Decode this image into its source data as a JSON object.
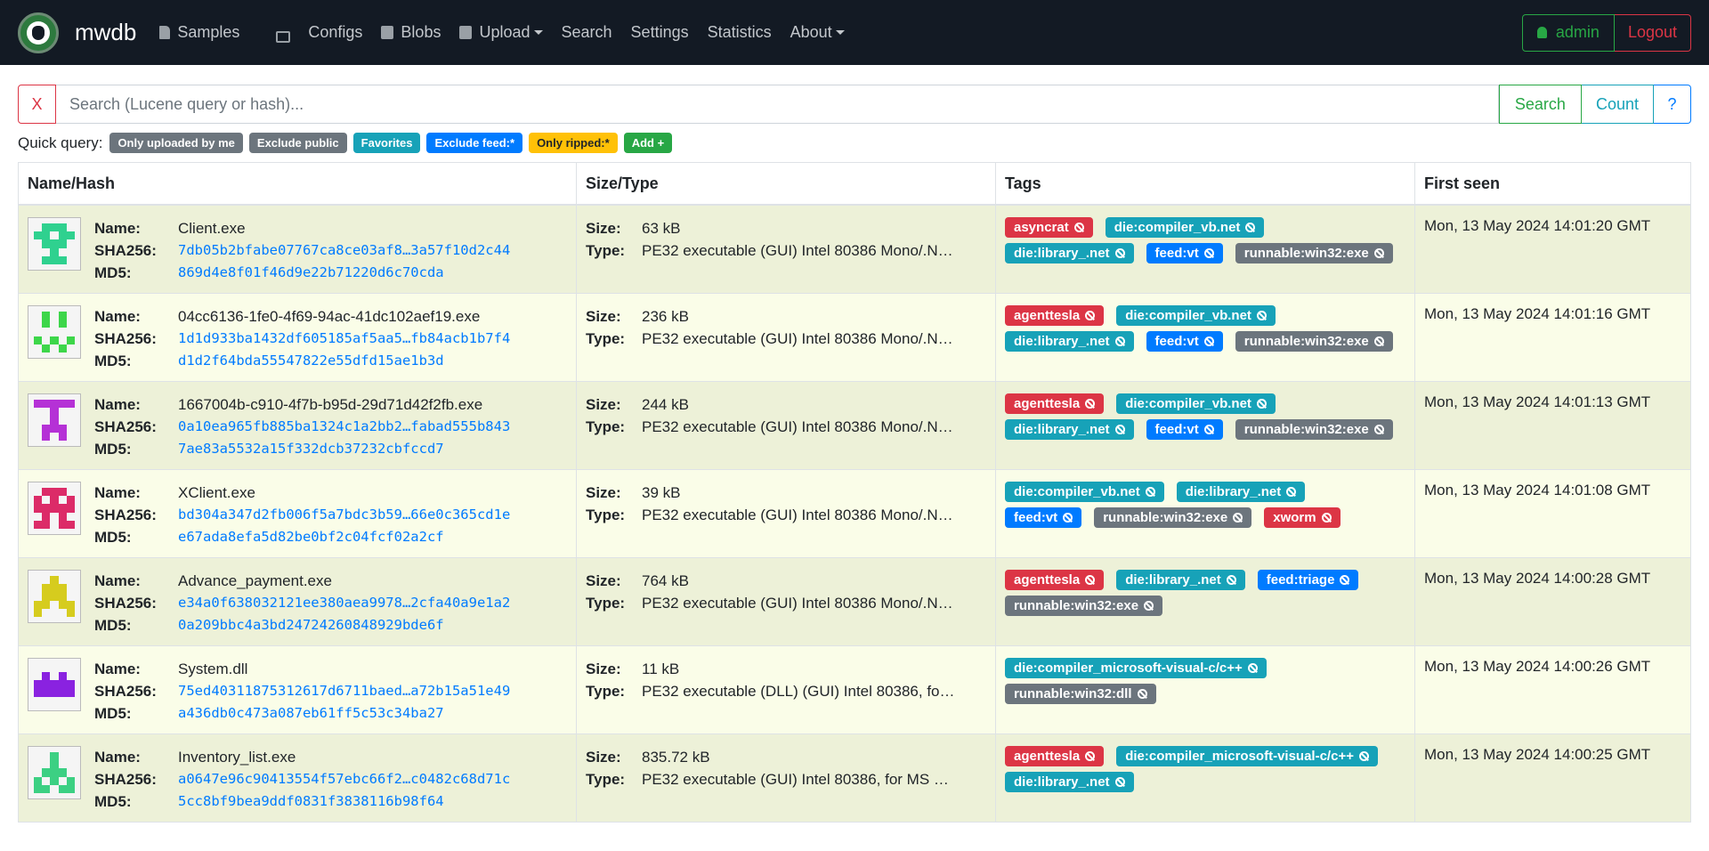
{
  "nav": {
    "brand": "mwdb",
    "items": [
      {
        "label": "Samples",
        "icon": "file-icon"
      },
      {
        "label": "Configs",
        "icon": "table-icon"
      },
      {
        "label": "Blobs",
        "icon": "blobs-icon"
      },
      {
        "label": "Upload",
        "icon": "upload-icon"
      },
      {
        "label": "Search",
        "icon": ""
      },
      {
        "label": "Settings",
        "icon": ""
      },
      {
        "label": "Statistics",
        "icon": ""
      },
      {
        "label": "About",
        "icon": ""
      }
    ],
    "user": "admin",
    "logout": "Logout"
  },
  "search": {
    "clear_label": "X",
    "placeholder": "Search (Lucene query or hash)...",
    "search_label": "Search",
    "count_label": "Count",
    "help_label": "?"
  },
  "quick": {
    "label": "Quick query:",
    "badges": [
      "Only uploaded by me",
      "Exclude public",
      "Favorites",
      "Exclude feed:*",
      "Only ripped:*",
      "Add +"
    ]
  },
  "table": {
    "headers": [
      "Name/Hash",
      "Size/Type",
      "Tags",
      "First seen"
    ],
    "labels": {
      "name": "Name:",
      "sha256": "SHA256:",
      "md5": "MD5:",
      "size": "Size:",
      "type": "Type:"
    },
    "rows": [
      {
        "name": "Client.exe",
        "sha256": "7db05b2bfabe07767ca8ce03af8…3a57f10d2c44",
        "md5": "869d4e8f01f46d9e22b71220d6c70cda",
        "size": "63 kB",
        "type": "PE32 executable (GUI) Intel 80386 Mono/.N…",
        "first_seen": "Mon, 13 May 2024 14:01:20 GMT",
        "tags": [
          {
            "t": "asyncrat",
            "c": "danger"
          },
          {
            "t": "die:compiler_vb.net",
            "c": "info"
          },
          {
            "t": "die:library_.net",
            "c": "info"
          },
          {
            "t": "feed:vt",
            "c": "primary"
          },
          {
            "t": "runnable:win32:exe",
            "c": "secondary"
          }
        ]
      },
      {
        "name": "04cc6136-1fe0-4f69-94ac-41dc102aef19.exe",
        "sha256": "1d1d933ba1432df605185af5aa5…fb84acb1b7f4",
        "md5": "d1d2f64bda55547822e55dfd15ae1b3d",
        "size": "236 kB",
        "type": "PE32 executable (GUI) Intel 80386 Mono/.N…",
        "first_seen": "Mon, 13 May 2024 14:01:16 GMT",
        "tags": [
          {
            "t": "agenttesla",
            "c": "danger"
          },
          {
            "t": "die:compiler_vb.net",
            "c": "info"
          },
          {
            "t": "die:library_.net",
            "c": "info"
          },
          {
            "t": "feed:vt",
            "c": "primary"
          },
          {
            "t": "runnable:win32:exe",
            "c": "secondary"
          }
        ]
      },
      {
        "name": "1667004b-c910-4f7b-b95d-29d71d42f2fb.exe",
        "sha256": "0a10ea965fb885ba1324c1a2bb2…fabad555b843",
        "md5": "7ae83a5532a15f332dcb37232cbfccd7",
        "size": "244 kB",
        "type": "PE32 executable (GUI) Intel 80386 Mono/.N…",
        "first_seen": "Mon, 13 May 2024 14:01:13 GMT",
        "tags": [
          {
            "t": "agenttesla",
            "c": "danger"
          },
          {
            "t": "die:compiler_vb.net",
            "c": "info"
          },
          {
            "t": "die:library_.net",
            "c": "info"
          },
          {
            "t": "feed:vt",
            "c": "primary"
          },
          {
            "t": "runnable:win32:exe",
            "c": "secondary"
          }
        ]
      },
      {
        "name": "XClient.exe",
        "sha256": "bd304a347d2fb006f5a7bdc3b59…66e0c365cd1e",
        "md5": "e67ada8efa5d82be0bf2c04fcf02a2cf",
        "size": "39 kB",
        "type": "PE32 executable (GUI) Intel 80386 Mono/.N…",
        "first_seen": "Mon, 13 May 2024 14:01:08 GMT",
        "tags": [
          {
            "t": "die:compiler_vb.net",
            "c": "info"
          },
          {
            "t": "die:library_.net",
            "c": "info"
          },
          {
            "t": "feed:vt",
            "c": "primary"
          },
          {
            "t": "runnable:win32:exe",
            "c": "secondary"
          },
          {
            "t": "xworm",
            "c": "danger"
          }
        ]
      },
      {
        "name": "Advance_payment.exe",
        "sha256": "e34a0f638032121ee380aea9978…2cfa40a9e1a2",
        "md5": "0a209bbc4a3bd24724260848929bde6f",
        "size": "764 kB",
        "type": "PE32 executable (GUI) Intel 80386 Mono/.N…",
        "first_seen": "Mon, 13 May 2024 14:00:28 GMT",
        "tags": [
          {
            "t": "agenttesla",
            "c": "danger"
          },
          {
            "t": "die:library_.net",
            "c": "info"
          },
          {
            "t": "feed:triage",
            "c": "primary"
          },
          {
            "t": "runnable:win32:exe",
            "c": "secondary"
          }
        ]
      },
      {
        "name": "System.dll",
        "sha256": "75ed40311875312617d6711baed…a72b15a51e49",
        "md5": "a436db0c473a087eb61ff5c53c34ba27",
        "size": "11 kB",
        "type": "PE32 executable (DLL) (GUI) Intel 80386, fo…",
        "first_seen": "Mon, 13 May 2024 14:00:26 GMT",
        "tags": [
          {
            "t": "die:compiler_microsoft-visual-c/c++",
            "c": "info"
          },
          {
            "t": "runnable:win32:dll",
            "c": "secondary"
          }
        ]
      },
      {
        "name": "Inventory_list.exe",
        "sha256": "a0647e96c90413554f57ebc66f2…c0482c68d71c",
        "md5": "5cc8bf9bea9ddf0831f3838116b98f64",
        "size": "835.72 kB",
        "type": "PE32 executable (GUI) Intel 80386, for MS …",
        "first_seen": "Mon, 13 May 2024 14:00:25 GMT",
        "tags": [
          {
            "t": "agenttesla",
            "c": "danger"
          },
          {
            "t": "die:compiler_microsoft-visual-c/c++",
            "c": "info"
          },
          {
            "t": "die:library_.net",
            "c": "info"
          }
        ]
      }
    ]
  },
  "colors": {
    "avatar_colors": [
      "#2fd18f",
      "#3dd64a",
      "#b531d6",
      "#dc2b68",
      "#d6cc1e",
      "#8a22e0",
      "#3cd083"
    ]
  }
}
